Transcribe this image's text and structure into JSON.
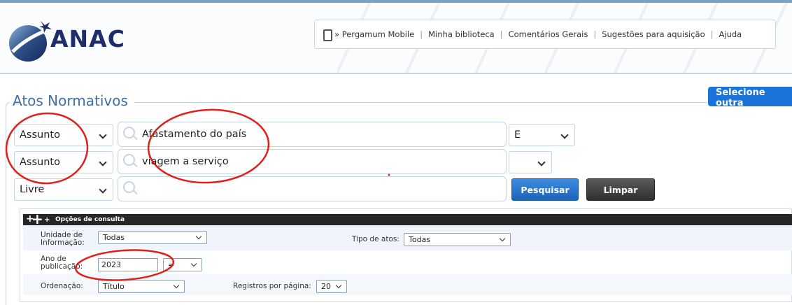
{
  "header": {
    "logo_text": "ANAC",
    "nav": [
      {
        "label": "» Pergamum Mobile"
      },
      {
        "label": "Minha biblioteca"
      },
      {
        "label": "Comentários Gerais"
      },
      {
        "label": "Sugestões para aquisição"
      },
      {
        "label": "Ajuda"
      }
    ]
  },
  "section": {
    "title": "Atos Normativos",
    "select_other_label": "Selecione outra"
  },
  "search_rows": [
    {
      "field": "Assunto",
      "term": "Afastamento do país",
      "operator": "E"
    },
    {
      "field": "Assunto",
      "term": "viagem a serviço",
      "operator": ""
    },
    {
      "field": "Livre",
      "term": "",
      "operator": null
    }
  ],
  "buttons": {
    "search_label": "Pesquisar",
    "clear_label": "Limpar"
  },
  "options": {
    "bar_label": "Opções de consulta",
    "unidade_label_1": "Unidade de",
    "unidade_label_2": "Informação:",
    "unidade_value": "Todas",
    "tipo_label": "Tipo de atos:",
    "tipo_value": "Todas",
    "ano_label_1": "Ano de",
    "ano_label_2": "publicação:",
    "ano_value": "2023",
    "ano_operator": "=",
    "ordenacao_label": "Ordenação:",
    "ordenacao_value": "Título",
    "registros_label": "Registros por página:",
    "registros_value": "20"
  },
  "annotation_color": "#e0201b",
  "brand_color": "#1e2d6b"
}
